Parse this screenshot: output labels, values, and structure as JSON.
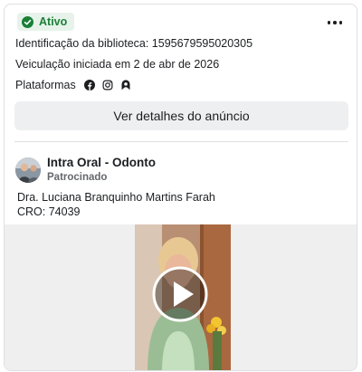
{
  "status": {
    "label": "Ativo",
    "color": "#1a7f37",
    "icon": "check-circle-icon"
  },
  "menu": {
    "icon": "more-horizontal-icon"
  },
  "info": {
    "library_id": "Identificação da biblioteca: 1595679595020305",
    "started": "Veiculação iniciada em 2 de abr de 2026",
    "platforms_label": "Plataformas",
    "platform_icons": [
      "facebook-icon",
      "instagram-icon",
      "audience-network-icon"
    ]
  },
  "details_button": "Ver detalhes do anúncio",
  "ad": {
    "page_name": "Intra Oral - Odonto",
    "sponsored": "Patrocinado",
    "body_lines": [
      "Dra. Luciana Branquinho Martins Farah",
      "CRO: 74039"
    ]
  },
  "media": {
    "type": "video",
    "play_icon": "play-icon"
  }
}
